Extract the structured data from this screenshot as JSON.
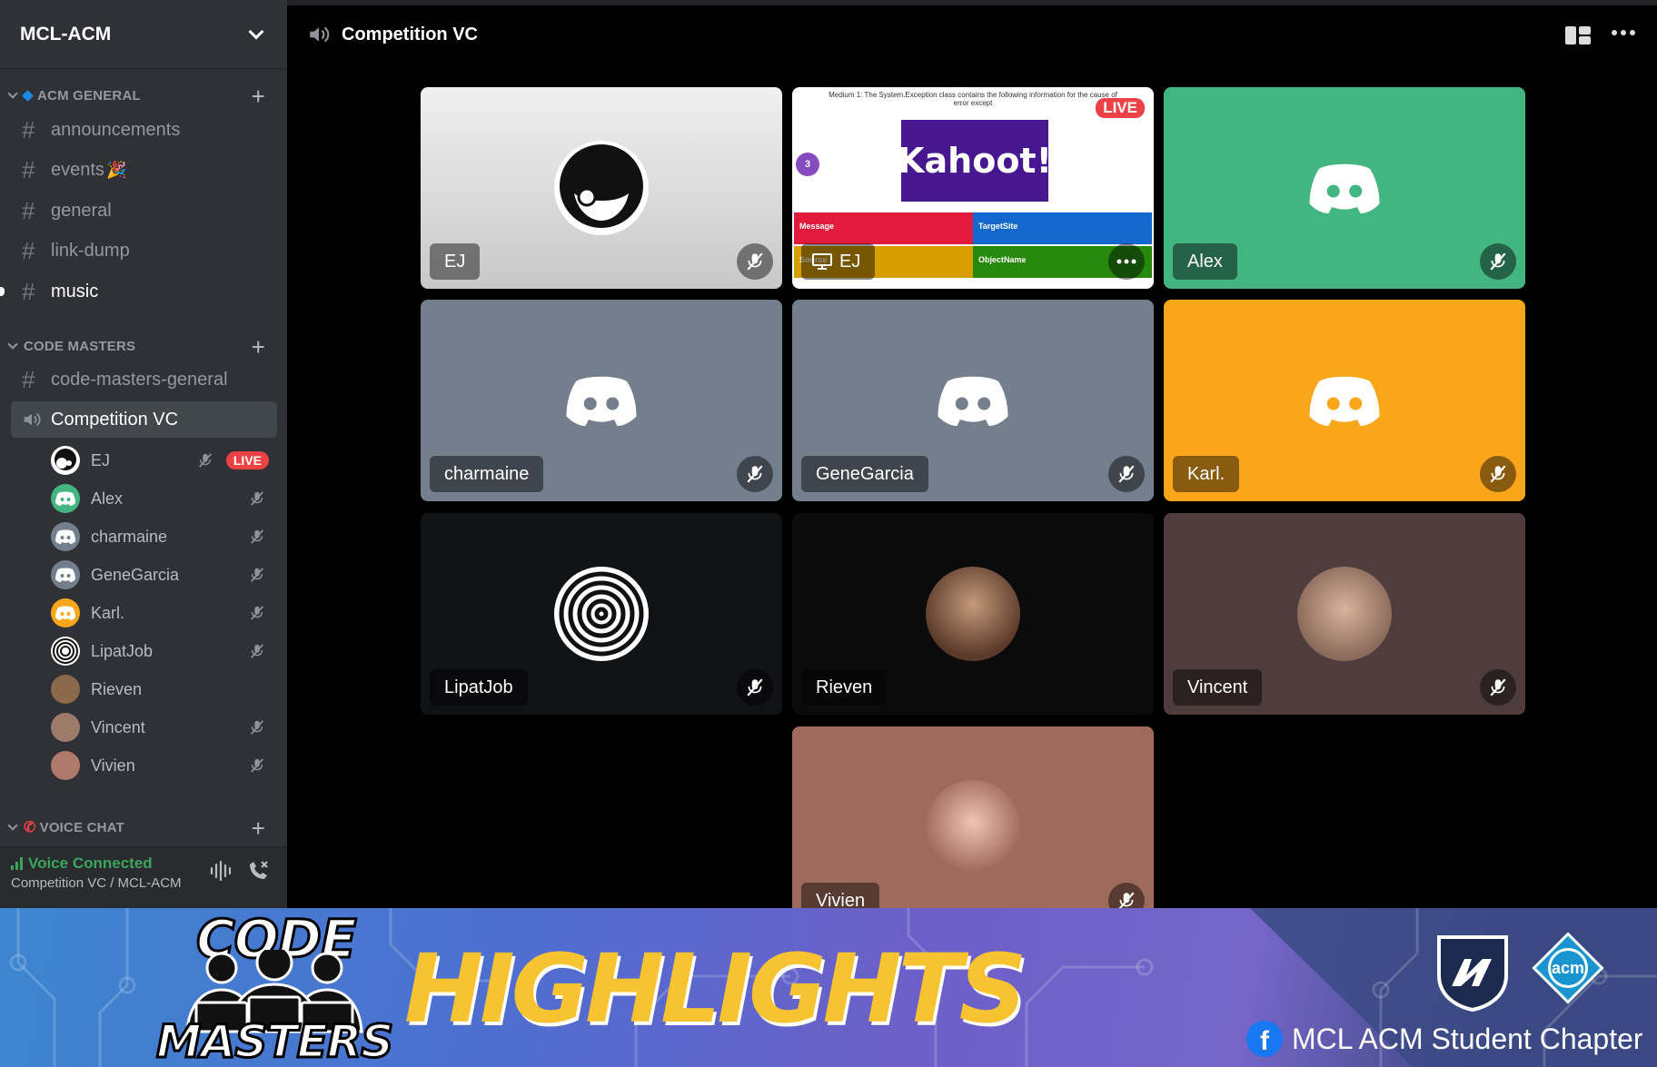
{
  "server": {
    "name": "MCL-ACM"
  },
  "categories": {
    "acm_general": "ACM GENERAL",
    "code_masters": "CODE MASTERS",
    "voice_chat": "VOICE CHAT"
  },
  "channels": {
    "announcements": "announcements",
    "events": "events",
    "general": "general",
    "link_dump": "link-dump",
    "music": "music",
    "code_masters_general": "code-masters-general",
    "competition_vc": "Competition VC"
  },
  "voice_users": [
    {
      "name": "EJ",
      "live": "LIVE"
    },
    {
      "name": "Alex"
    },
    {
      "name": "charmaine"
    },
    {
      "name": "GeneGarcia"
    },
    {
      "name": "Karl."
    },
    {
      "name": "LipatJob"
    },
    {
      "name": "Rieven"
    },
    {
      "name": "Vincent"
    },
    {
      "name": "Vivien"
    }
  ],
  "voice_panel": {
    "status": "Voice Connected",
    "location": "Competition VC / MCL-ACM"
  },
  "main": {
    "title": "Competition VC"
  },
  "tiles": {
    "ej": "EJ",
    "ej_stream": "EJ",
    "alex": "Alex",
    "charmaine": "charmaine",
    "genegarcia": "GeneGarcia",
    "karl": "Karl.",
    "lipatjob": "LipatJob",
    "rieven": "Rieven",
    "vincent": "Vincent",
    "vivien": "Vivien"
  },
  "kahoot": {
    "question": "Medium 1: The System.Exception class contains the following information for the cause of error except",
    "logo": "Kahoot!",
    "live": "LIVE",
    "timer": "3",
    "answers": [
      "Message",
      "TargetSite",
      "Source",
      "ObjectName"
    ]
  },
  "banner": {
    "code": "CODE",
    "masters": "MASTERS",
    "highlights": "HIGHLIGHTS",
    "facebook_page": "MCL ACM Student Chapter",
    "acm_logo": "acm"
  },
  "colors": {
    "sidebar": "#2f3136",
    "voice_green": "#3ba55d",
    "live_red": "#ed4245",
    "tile_grey": "#747f8d",
    "alex_green": "#43b581",
    "karl_orange": "#faa61a",
    "highlight_yellow": "#f7c331"
  }
}
